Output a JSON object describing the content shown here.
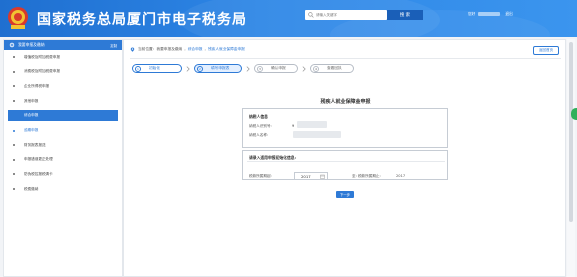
{
  "header": {
    "title": "国家税务总局厦门市电子税务局",
    "search_placeholder": "请输入关键字",
    "search_button": "搜 索",
    "user_prefix": "您好",
    "logout": "退出",
    "colors": {
      "primary": "#2e7ad6",
      "header": "#1f6fd0"
    }
  },
  "sidebar": {
    "title": "我要申报及缴纳",
    "tag": "定制",
    "items": [
      {
        "label": "增值税及附加税费申报"
      },
      {
        "label": "消费税及附加税费申报"
      },
      {
        "label": "企业所得税申报"
      },
      {
        "label": "其他申报"
      },
      {
        "label": "综合申报"
      },
      {
        "label": "逾期申报"
      },
      {
        "label": "财务报表报送"
      },
      {
        "label": "申报错误更正处理"
      },
      {
        "label": "防伪税控报税清卡"
      },
      {
        "label": "税费缴纳"
      }
    ]
  },
  "main": {
    "breadcrumb": {
      "prefix": "当前位置：",
      "root": "我要申报及缴纳",
      "mid": "综合申报",
      "current": "残疾人就业保障金申报"
    },
    "back_button": "返回首页",
    "steps": [
      {
        "num": "1",
        "label": "初始化",
        "state": "done"
      },
      {
        "num": "2",
        "label": "填写申报表",
        "state": "current"
      },
      {
        "num": "3",
        "label": "确认申报",
        "state": "todo"
      },
      {
        "num": "4",
        "label": "查看回执",
        "state": "todo"
      }
    ],
    "form_title": "残疾人就业保障金申报",
    "taxpayer": {
      "section_title": "纳税人信息",
      "id_label": "纳税人识别号:",
      "id_value": "9",
      "name_label": "纳税人名称:"
    },
    "period": {
      "section_title": "请录入适用申报初始化信息:",
      "start_label": "税款所属期起:",
      "start_value": "2017",
      "end_label": "至: 税款所属期止:",
      "end_value": "2017"
    },
    "next_button": "下一步"
  }
}
